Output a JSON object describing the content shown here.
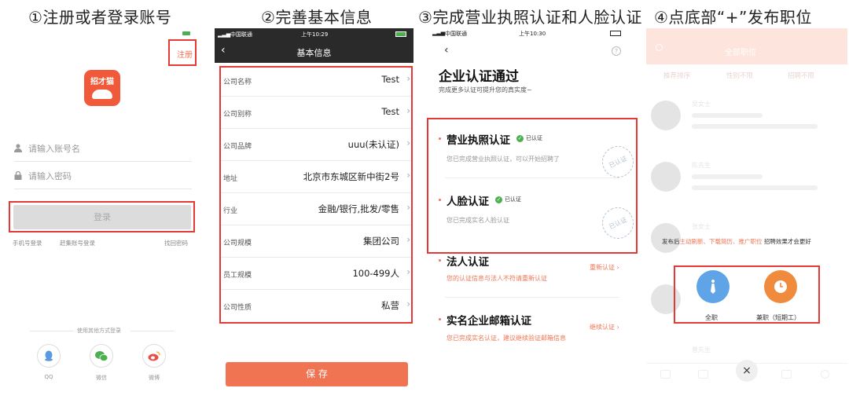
{
  "steps": {
    "s1": "①注册或者登录账号",
    "s2": "②完善基本信息",
    "s3": "③完成营业执照认证和人脸认证",
    "s4": "④点底部“+”发布职位"
  },
  "login": {
    "register": "注册",
    "logo_text": "招才猫",
    "account_placeholder": "请输入账号名",
    "password_placeholder": "请输入密码",
    "login_button": "登录",
    "phone_login": "手机号登录",
    "ganji_login": "赶集账号登录",
    "forgot": "找回密码",
    "other_methods": "使用其他方式登录",
    "qq": "QQ",
    "wechat": "微信",
    "weibo": "微博"
  },
  "statusbar": {
    "carrier": "中国联通",
    "time2": "上午10:29",
    "time3": "上午10:30"
  },
  "info": {
    "title": "基本信息",
    "save": "保 存",
    "rows": [
      {
        "k": "公司名称",
        "v": "Test"
      },
      {
        "k": "公司别称",
        "v": "Test"
      },
      {
        "k": "公司品牌",
        "v": "uuu(未认证)"
      },
      {
        "k": "地址",
        "v": "北京市东城区新中街2号"
      },
      {
        "k": "行业",
        "v": "金融/银行,批发/零售"
      },
      {
        "k": "公司规模",
        "v": "集团公司"
      },
      {
        "k": "员工规模",
        "v": "100-499人"
      },
      {
        "k": "公司性质",
        "v": "私营"
      }
    ]
  },
  "cert": {
    "heading": "企业认证通过",
    "sub": "完成更多认证可提升您的真实度~",
    "license_title": "营业执照认证",
    "license_badge": "已认证",
    "license_desc": "您已完成营业执照认证，可以开始招聘了",
    "face_title": "人脸认证",
    "face_badge": "已认证",
    "face_desc": "您已完成实名人脸认证",
    "legal_title": "法人认证",
    "legal_desc": "您的认证信息与法人不符请重新认证",
    "legal_action": "重新认证",
    "email_title": "实名企业邮箱认证",
    "email_desc": "您已完成实名认证，建议继续验证邮箱信息",
    "email_action": "继续认证",
    "stamp": "已认证"
  },
  "post": {
    "topbar": "全部职位",
    "filters": [
      "推荐排序",
      "性别不限",
      "招聘不限"
    ],
    "tip_pre": "发布后",
    "tip_hl": "主动刷新、下载简历、推广职位",
    "tip_post": "招聘效果才会更好",
    "fulltime": "全职",
    "parttime": "兼职（短期工）",
    "close": "×",
    "ghost_names": [
      "吴女士",
      "陈先生",
      "张女士",
      "曾先生"
    ]
  },
  "colors": {
    "accent": "#f07452",
    "red": "#e53935",
    "green": "#4caf50"
  }
}
